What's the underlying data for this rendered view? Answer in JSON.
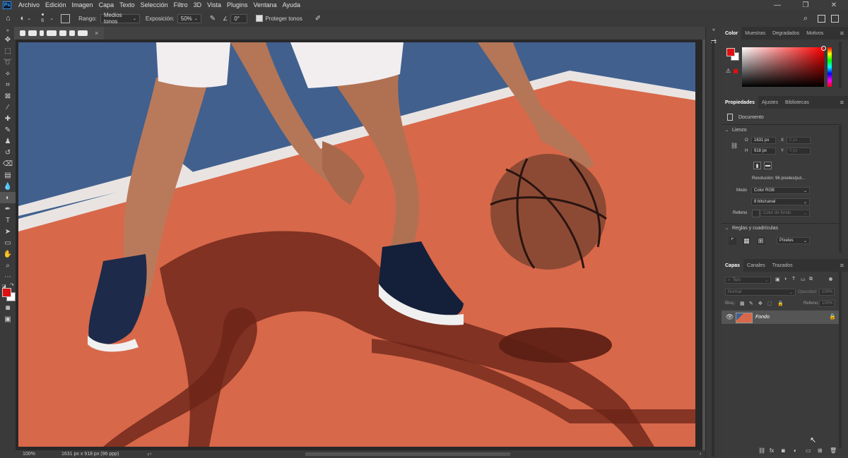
{
  "menu": {
    "app_logo": "Ps",
    "items": [
      "Archivo",
      "Edición",
      "Imagen",
      "Capa",
      "Texto",
      "Selección",
      "Filtro",
      "3D",
      "Vista",
      "Plugins",
      "Ventana",
      "Ayuda"
    ],
    "window_controls": [
      "—",
      "❐",
      "✕"
    ]
  },
  "options": {
    "brush_size": "6",
    "range_label": "Rango:",
    "range_value": "Medios tonos",
    "exposure_label": "Exposición:",
    "exposure_value": "50%",
    "angle_value": "0°",
    "protect_tones": "Proteger tonos",
    "protect_tones_checked": true
  },
  "document": {
    "tab_close": "×"
  },
  "status": {
    "zoom": "100%",
    "dimensions": "1631 px x 918 px (96 ppp)",
    "arrow": "›"
  },
  "color_panel": {
    "tabs": [
      "Color",
      "Muestras",
      "Degradados",
      "Motivos"
    ],
    "active_tab": "Color",
    "foreground": "#e01010",
    "background": "#ffffff",
    "hue": "#ff0000"
  },
  "properties_panel": {
    "tabs": [
      "Propiedades",
      "Ajustes",
      "Bibliotecas"
    ],
    "active_tab": "Propiedades",
    "type_label": "Documento",
    "canvas_section": "Lienzo",
    "width_label": "O",
    "width_value": "1631 px",
    "height_label": "H",
    "height_value": "918 px",
    "x_label": "X",
    "x_value": "0 px",
    "y_label": "Y",
    "y_value": "0 px",
    "resolution": "Resolución: 96 píxeles/pul...",
    "mode_label": "Modo",
    "mode_value": "Color RGB",
    "bits_value": "8 bits/canal",
    "fill_label": "Relleno",
    "fill_value": "Color de fondo",
    "rulers_section": "Reglas y cuadrículas",
    "units_value": "Píxeles"
  },
  "layers_panel": {
    "tabs": [
      "Capas",
      "Canales",
      "Trazados"
    ],
    "active_tab": "Capas",
    "search_placeholder": "Tipo",
    "blend_mode": "Normal",
    "opacity_label": "Opacidad:",
    "opacity_value": "100%",
    "lock_label": "Bloq.:",
    "fill_label": "Relleno:",
    "fill_value": "100%",
    "layers": [
      {
        "name": "Fondo",
        "visible": true,
        "locked": true
      }
    ]
  },
  "colors": {
    "court_orange": "#d8684a",
    "court_blue": "#41608e",
    "accent": "#31a8ff"
  }
}
